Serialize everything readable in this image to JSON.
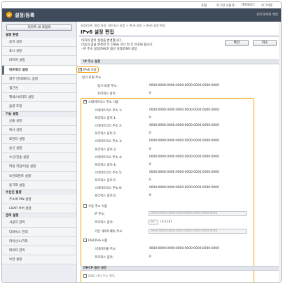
{
  "topbar": {
    "portal_link": "포털",
    "login_user_label": "로그인 사용자:",
    "login_user_value": "7654321",
    "logout": "로그아웃"
  },
  "header": {
    "title": "설정/등록",
    "manager_link": "관리자에게 메일"
  },
  "sidebar": {
    "portal_button": "리모트 UI 포털로",
    "groups": [
      {
        "heading": "설정 환경",
        "items": [
          "용지 설정",
          "표시 설정",
          "타이머 설정",
          "네트워크 설정",
          "외부 인터페이스 설정",
          "접근성",
          "액세스비리티 설정",
          "음량 조정"
        ]
      },
      {
        "heading": "기능 설정",
        "items": [
          "공통 설정",
          "복사 설정",
          "프린터 설정",
          "송신 설정",
          "수신/전송 설정",
          "파일 저장/이용 설정",
          "보안프린트 설정",
          "동기화 설정"
        ]
      },
      {
        "heading": "수신인 설정",
        "items": [
          "주소록 PIN 설정",
          "LDAP 서버 설정"
        ]
      },
      {
        "heading": "관리 설정",
        "items": [
          "사용자 관리",
          "디바이스 관리",
          "라이선스/기타",
          "데이터 관리",
          "보안 설정"
        ]
      }
    ],
    "active_item": "네트워크 설정"
  },
  "main": {
    "breadcrumb": "설정/등록: 환경 설정: 네트워크 설정 > IPv6 설정 > IPv6 설정 편집",
    "title": "IPv6 설정 편집",
    "notes": [
      "이하의 값이 설정을 변경합니다.",
      "다음의 값을 변경한 후 전원을 끈다 켠 후 유효화 됩니다.",
      "- IP 주소 설정/DHCP 옵션 설정/DNS 설정."
    ],
    "ok_button": "확인",
    "cancel_button": "취소",
    "ip_section": "IP 주소 설정",
    "use_ipv6": "IPv6 사용",
    "link_local_heading": "링크-로컬 주소",
    "link_local_address_label": "링크-로컬 주소:",
    "link_local_address_value": "0000:0000:0000:0000:0000:0000:0000:0000",
    "link_local_prefix_label": "프리픽스 길이:",
    "link_local_prefix_value": "0",
    "stateless_label": "스테이트리스 주소 사용",
    "stateless_rows": [
      {
        "label": "스테이트리스 주소 1:",
        "value": "0000:0000:0000:0000:0000:0000:0000:0000"
      },
      {
        "label": "프리픽스 길이 1:",
        "value": "0"
      },
      {
        "label": "스테이트리스 주소 2:",
        "value": "0000:0000:0000:0000:0000:0000:0000:0000"
      },
      {
        "label": "프리픽스 길이 2:",
        "value": "0"
      },
      {
        "label": "스테이트리스 주소 3:",
        "value": "0000:0000:0000:0000:0000:0000:0000:0000"
      },
      {
        "label": "프리픽스 길이 3:",
        "value": "0"
      },
      {
        "label": "스테이트리스 주소 4:",
        "value": "0000:0000:0000:0000:0000:0000:0000:0000"
      },
      {
        "label": "프리픽스 길이 4:",
        "value": "0"
      },
      {
        "label": "스테이트리스 주소 5:",
        "value": "0000:0000:0000:0000:0000:0000:0000:0000"
      },
      {
        "label": "프리픽스 길이 5:",
        "value": "0"
      },
      {
        "label": "스테이트리스 주소 6:",
        "value": "0000:0000:0000:0000:0000:0000:0000:0000"
      },
      {
        "label": "프리픽스 길이 6:",
        "value": "0"
      }
    ],
    "manual_label": "수동 주소 사용",
    "manual_ip_label": "IP 주소:",
    "manual_ip_value": "0000:0000:0000:0000:0000:0000:0000:0000",
    "manual_prefix_label": "프리픽스 길이:",
    "manual_prefix_value": "64",
    "manual_prefix_range": "(0-128)",
    "manual_gateway_label": "기본 게이트웨이 주소:",
    "manual_gateway_value": "0000:0000:0000:0000:0000:0000:0000:0000",
    "dhcpv6_label": "DHCPv6 사용",
    "dhcpv6_stateful_label": "스테이트풀 주소:",
    "dhcpv6_stateful_value": "0000:0000:0000:0000:0000:0000:0000:0000",
    "dhcpv6_prefix_label": "프리픽스 길이:",
    "dhcpv6_prefix_value": "0",
    "dhcp_section": "DHCP 옵션 설정",
    "dns_option_label": "DNS 서버 주소 취득"
  }
}
